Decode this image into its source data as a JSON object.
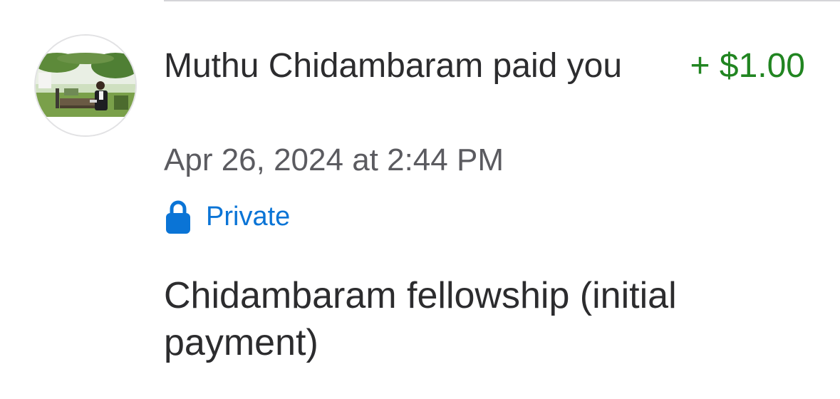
{
  "transaction": {
    "payer_name": "Muthu Chidambaram",
    "action": "paid",
    "recipient": "you",
    "amount": "+ $1.00",
    "timestamp": "Apr 26, 2024 at 2:44 PM",
    "privacy": {
      "icon": "lock-icon",
      "label": "Private"
    },
    "note": "Chidambaram fellowship (initial payment)"
  },
  "colors": {
    "amount_positive": "#218521",
    "privacy_link": "#0a74d6",
    "timestamp_text": "#5b5b60",
    "primary_text": "#2c2c2e"
  }
}
